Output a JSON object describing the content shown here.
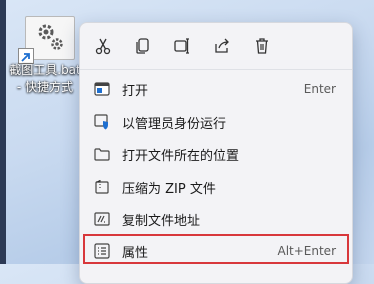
{
  "desktop": {
    "shortcut_label_line1": "截图工具.bat",
    "shortcut_label_line2": "- 快捷方式"
  },
  "context_menu": {
    "quick_actions": [
      "cut-icon",
      "copy-icon",
      "rename-icon",
      "share-icon",
      "delete-icon"
    ],
    "items": [
      {
        "label": "打开",
        "shortcut": "Enter",
        "icon": "open-icon"
      },
      {
        "label": "以管理员身份运行",
        "shortcut": "",
        "icon": "shield-icon"
      },
      {
        "label": "打开文件所在的位置",
        "shortcut": "",
        "icon": "folder-icon"
      },
      {
        "label": "压缩为 ZIP 文件",
        "shortcut": "",
        "icon": "zip-icon"
      },
      {
        "label": "复制文件地址",
        "shortcut": "",
        "icon": "copy-path-icon"
      },
      {
        "label": "属性",
        "shortcut": "Alt+Enter",
        "icon": "properties-icon"
      }
    ]
  },
  "colors": {
    "accent": "#0067c0",
    "highlight_border": "#d8373b"
  }
}
